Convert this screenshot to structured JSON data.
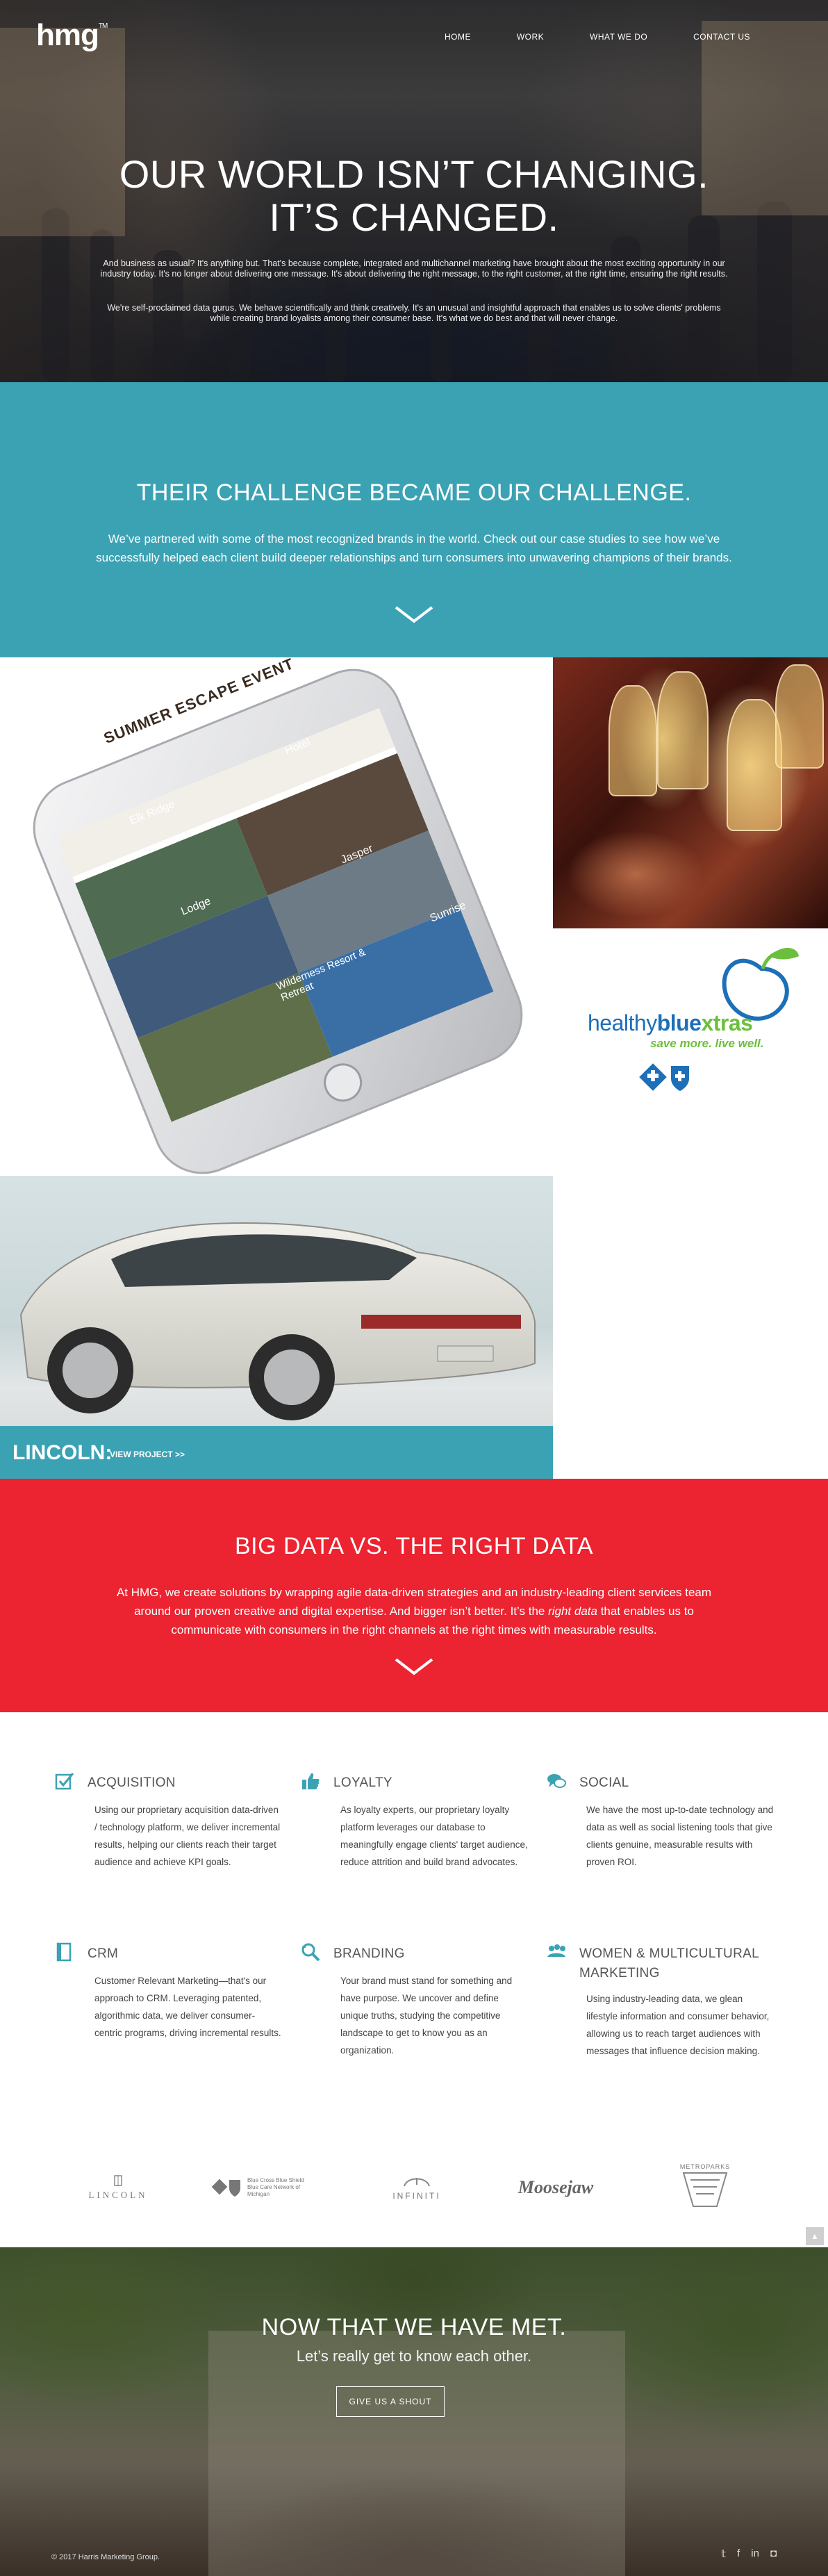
{
  "header": {
    "logo": "hmg",
    "logo_tm": "TM",
    "nav": [
      {
        "label": "HOME",
        "active": true
      },
      {
        "label": "WORK"
      },
      {
        "label": "WHAT WE DO"
      },
      {
        "label": "CONTACT US"
      }
    ]
  },
  "hero": {
    "title_line1": "OUR WORLD ISN’T CHANGING.",
    "title_line2": "IT’S CHANGED.",
    "para1": "And business as usual? It's anything but. That's because complete, integrated and multichannel marketing have brought about the most exciting opportunity in our industry today. It's no longer about delivering one message. It's about delivering the right message, to the right customer, at the right time, ensuring the right results.",
    "para2": "We're self-proclaimed data gurus. We behave scientifically and think creatively. It's an unusual and insightful approach that enables us to solve clients' problems while creating brand loyalists among their consumer base. It's what we do best and that will never change."
  },
  "challenge": {
    "title": "THEIR CHALLENGE BECAME OUR CHALLENGE.",
    "body": "We’ve partnered with some of the most recognized brands in the world. Check out our case studies to see how we’ve successfully helped each client build deeper relationships and turn consumers into unwavering champions of their brands."
  },
  "projects": {
    "phone": {
      "event_title": "SUMMER ESCAPE EVENT",
      "tiles": [
        "Elk Ridge",
        "Hotel",
        "Jasper",
        "Sunrise",
        "Wilderness Resort & Retreat",
        "Lodge"
      ]
    },
    "healthy_blue": {
      "logo_word1": "healthy",
      "logo_word2": "blue",
      "logo_word3": "xtras",
      "tagline": "save more. live well."
    },
    "lincoln": {
      "brand": "LINCOLN:",
      "cta": "VIEW PROJECT >>"
    }
  },
  "bigdata": {
    "title": "BIG DATA VS. THE RIGHT DATA",
    "body_before": "At HMG, we create solutions by wrapping agile data-driven strategies and an industry-leading client services team around our proven creative and digital expertise. And bigger isn’t better. It’s the ",
    "body_em": "right data",
    "body_after": " that enables us to communicate with consumers in the right channels at the right times with measurable results."
  },
  "services": [
    {
      "icon": "checkbox-icon",
      "title": "ACQUISITION",
      "body": "Using our proprietary acquisition data-driven / technology platform, we deliver incremental results, helping our clients reach their target audience and achieve KPI goals."
    },
    {
      "icon": "thumbs-up-icon",
      "title": "LOYALTY",
      "body": "As loyalty experts, our proprietary loyalty platform leverages our database to meaningfully engage clients' target audience, reduce attrition and build brand advocates."
    },
    {
      "icon": "chat-bubbles-icon",
      "title": "SOCIAL",
      "body": "We have the most up-to-date technology and data as well as social listening tools that give clients genuine, measurable results with proven ROI."
    },
    {
      "icon": "document-icon",
      "title": "CRM",
      "body": "Customer Relevant Marketing—that's our approach to CRM. Leveraging patented, algorithmic data, we deliver consumer-centric programs, driving incremental results."
    },
    {
      "icon": "magnifier-icon",
      "title": "BRANDING",
      "body": "Your brand must stand for something and have purpose. We uncover and define unique truths, studying the competitive landscape to get to know you as an organization."
    },
    {
      "icon": "people-icon",
      "title": "WOMEN & MULTICULTURAL MARKETING",
      "body": "Using industry-leading data, we glean lifestyle information and consumer behavior, allowing us to reach target audiences with messages that influence decision making."
    }
  ],
  "client_logos": [
    "LINCOLN",
    "Blue Cross Blue Shield Blue Care Network of Michigan",
    "INFINITI",
    "Moosejaw",
    "METROPARKS"
  ],
  "footer": {
    "title": "NOW THAT WE HAVE MET.",
    "subtitle": "Let’s really get to know each other.",
    "button": "GIVE US A SHOUT",
    "copyright": "© 2017 Harris Marketing Group.",
    "social": [
      "twitter-icon",
      "facebook-icon",
      "linkedin-icon",
      "instagram-icon"
    ]
  },
  "colors": {
    "teal": "#3ba2b4",
    "red": "#ec2330",
    "blue": "#1d6fb8",
    "green": "#6cbf3c"
  }
}
